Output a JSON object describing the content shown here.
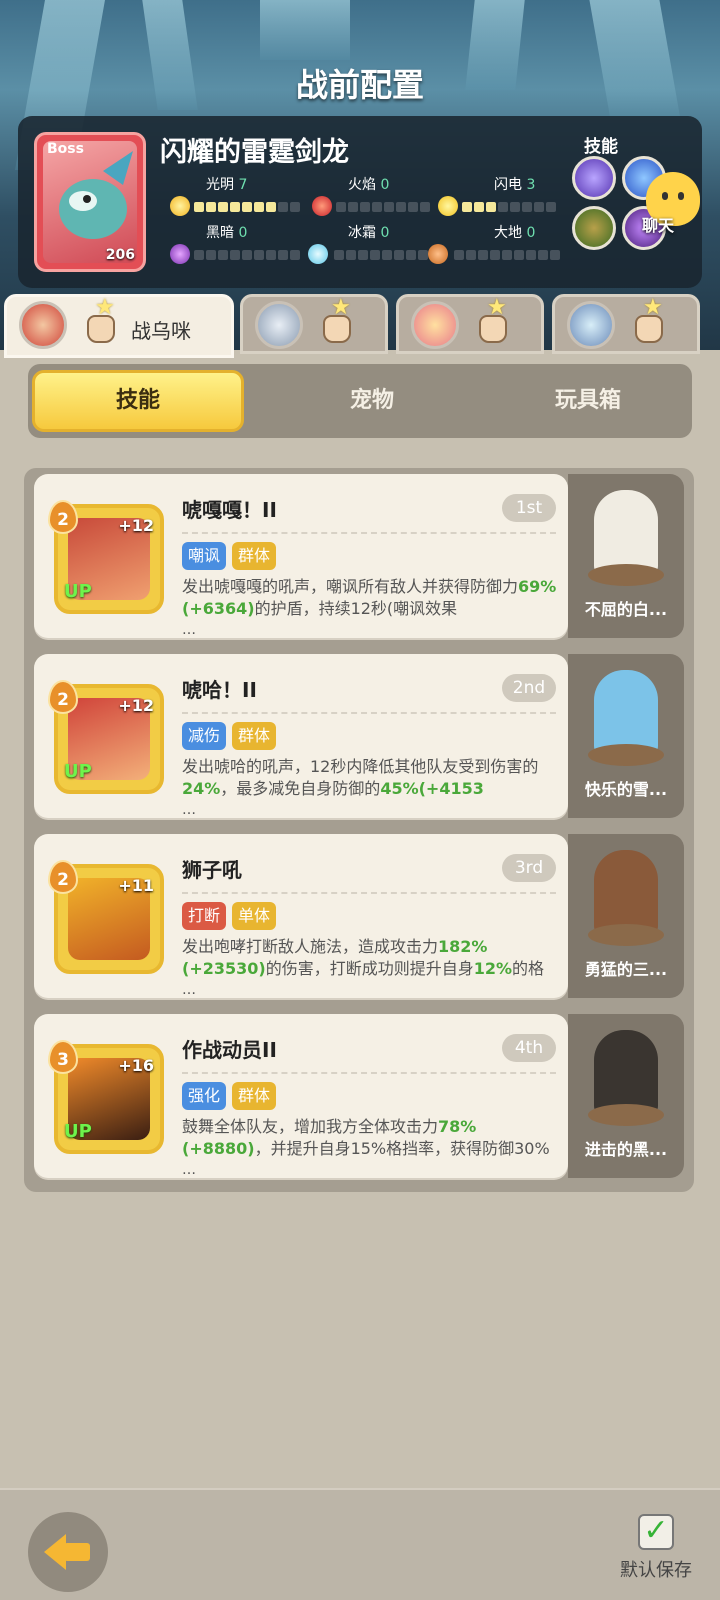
{
  "screen_title": "战前配置",
  "boss": {
    "tag": "Boss",
    "name": "闪耀的雷霆剑龙",
    "level": "206",
    "elements": [
      {
        "label": "光明",
        "value": "7"
      },
      {
        "label": "火焰",
        "value": "0"
      },
      {
        "label": "闪电",
        "value": "3"
      },
      {
        "label": "黑暗",
        "value": "0"
      },
      {
        "label": "冰霜",
        "value": "0"
      },
      {
        "label": "大地",
        "value": "0"
      }
    ],
    "skills_label": "技能"
  },
  "chat_label": "聊天",
  "hero_tabs": [
    {
      "name": "战乌咪"
    },
    {
      "name": ""
    },
    {
      "name": ""
    },
    {
      "name": ""
    }
  ],
  "segments": [
    "技能",
    "宠物",
    "玩具箱"
  ],
  "skills": [
    {
      "name": "唬嘎嘎！II",
      "rank": "1st",
      "level": "2",
      "plus": "+12",
      "up": "UP",
      "tags": [
        "嘲讽",
        "群体"
      ],
      "desc_parts": [
        "发出唬嘎嘎的吼声，嘲讽所有敌人并获得防御力",
        "69%(+6364)",
        "的护盾，持续12秒(嘲讽效果"
      ],
      "ellipsis": "…"
    },
    {
      "name": "唬哈！II",
      "rank": "2nd",
      "level": "2",
      "plus": "+12",
      "up": "UP",
      "tags": [
        "减伤",
        "群体"
      ],
      "desc_parts": [
        "发出唬哈的吼声，12秒内降低其他队友受到伤害的",
        "24%",
        "，最多减免自身防御的",
        "45%(+4153"
      ],
      "ellipsis": "…"
    },
    {
      "name": "狮子吼",
      "rank": "3rd",
      "level": "2",
      "plus": "+11",
      "up": "",
      "tags": [
        "打断",
        "单体"
      ],
      "desc_parts": [
        "发出咆哮打断敌人施法，造成攻击力",
        "182%(+23530)",
        "的伤害，打断成功则提升自身",
        "12%",
        "的格"
      ],
      "ellipsis": "…"
    },
    {
      "name": "作战动员II",
      "rank": "4th",
      "level": "3",
      "plus": "+16",
      "up": "UP",
      "tags": [
        "强化",
        "群体"
      ],
      "desc_parts": [
        "鼓舞全体队友，增加我方全体攻击力",
        "78%(+8880)",
        "，并提升自身15%格挡率，获得防御30%"
      ],
      "ellipsis": "…"
    }
  ],
  "pets": [
    {
      "name": "不屈的白..."
    },
    {
      "name": "快乐的雪..."
    },
    {
      "name": "勇猛的三..."
    },
    {
      "name": "进击的黑..."
    }
  ],
  "save_label": "默认保存"
}
